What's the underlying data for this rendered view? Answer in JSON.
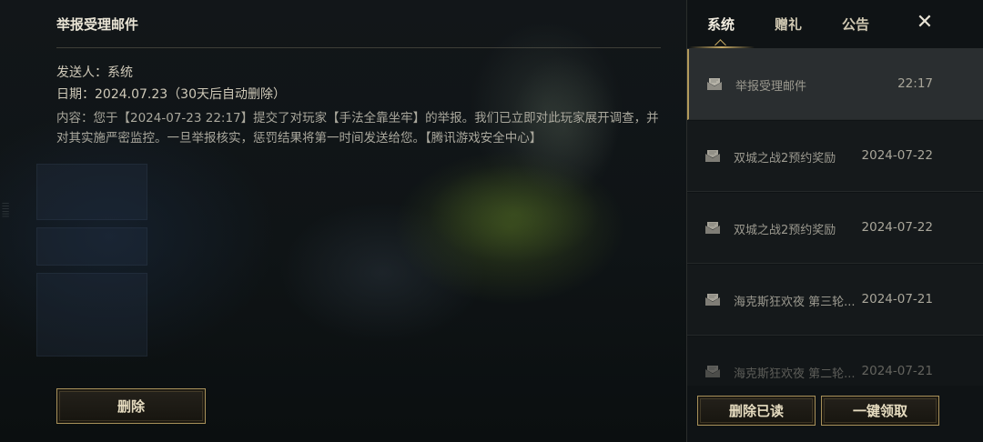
{
  "detail": {
    "title": "举报受理邮件",
    "sender": "发送人：系统",
    "date": "日期：2024.07.23（30天后自动删除）",
    "content": "内容：您于【2024-07-23 22:17】提交了对玩家【手法全靠坐牢】的举报。我们已立即对此玩家展开调查，并对其实施严密监控。一旦举报核实，惩罚结果将第一时间发送给您。【腾讯游戏安全中心】",
    "delete_label": "删除"
  },
  "tabs": [
    {
      "label": "系统",
      "active": true
    },
    {
      "label": "赠礼",
      "active": false
    },
    {
      "label": "公告",
      "active": false
    }
  ],
  "close_label": "✕",
  "mails": [
    {
      "subject": "举报受理邮件",
      "date": "22:17",
      "icon": "mail-icon",
      "selected": true
    },
    {
      "subject": "双城之战2预约奖励",
      "date": "2024-07-22",
      "icon": "mail-icon"
    },
    {
      "subject": "双城之战2预约奖励",
      "date": "2024-07-22",
      "icon": "mail-icon"
    },
    {
      "subject": "海克斯狂欢夜 第三轮...",
      "date": "2024-07-21",
      "icon": "mail-icon"
    },
    {
      "subject": "海克斯狂欢夜 第二轮...",
      "date": "2024-07-21",
      "icon": "mail-icon"
    }
  ],
  "footer": {
    "delete_read_label": "删除已读",
    "claim_all_label": "一键领取"
  },
  "colors": {
    "accent_gold": "#a8915a",
    "selected_row": "#2a2e30"
  }
}
